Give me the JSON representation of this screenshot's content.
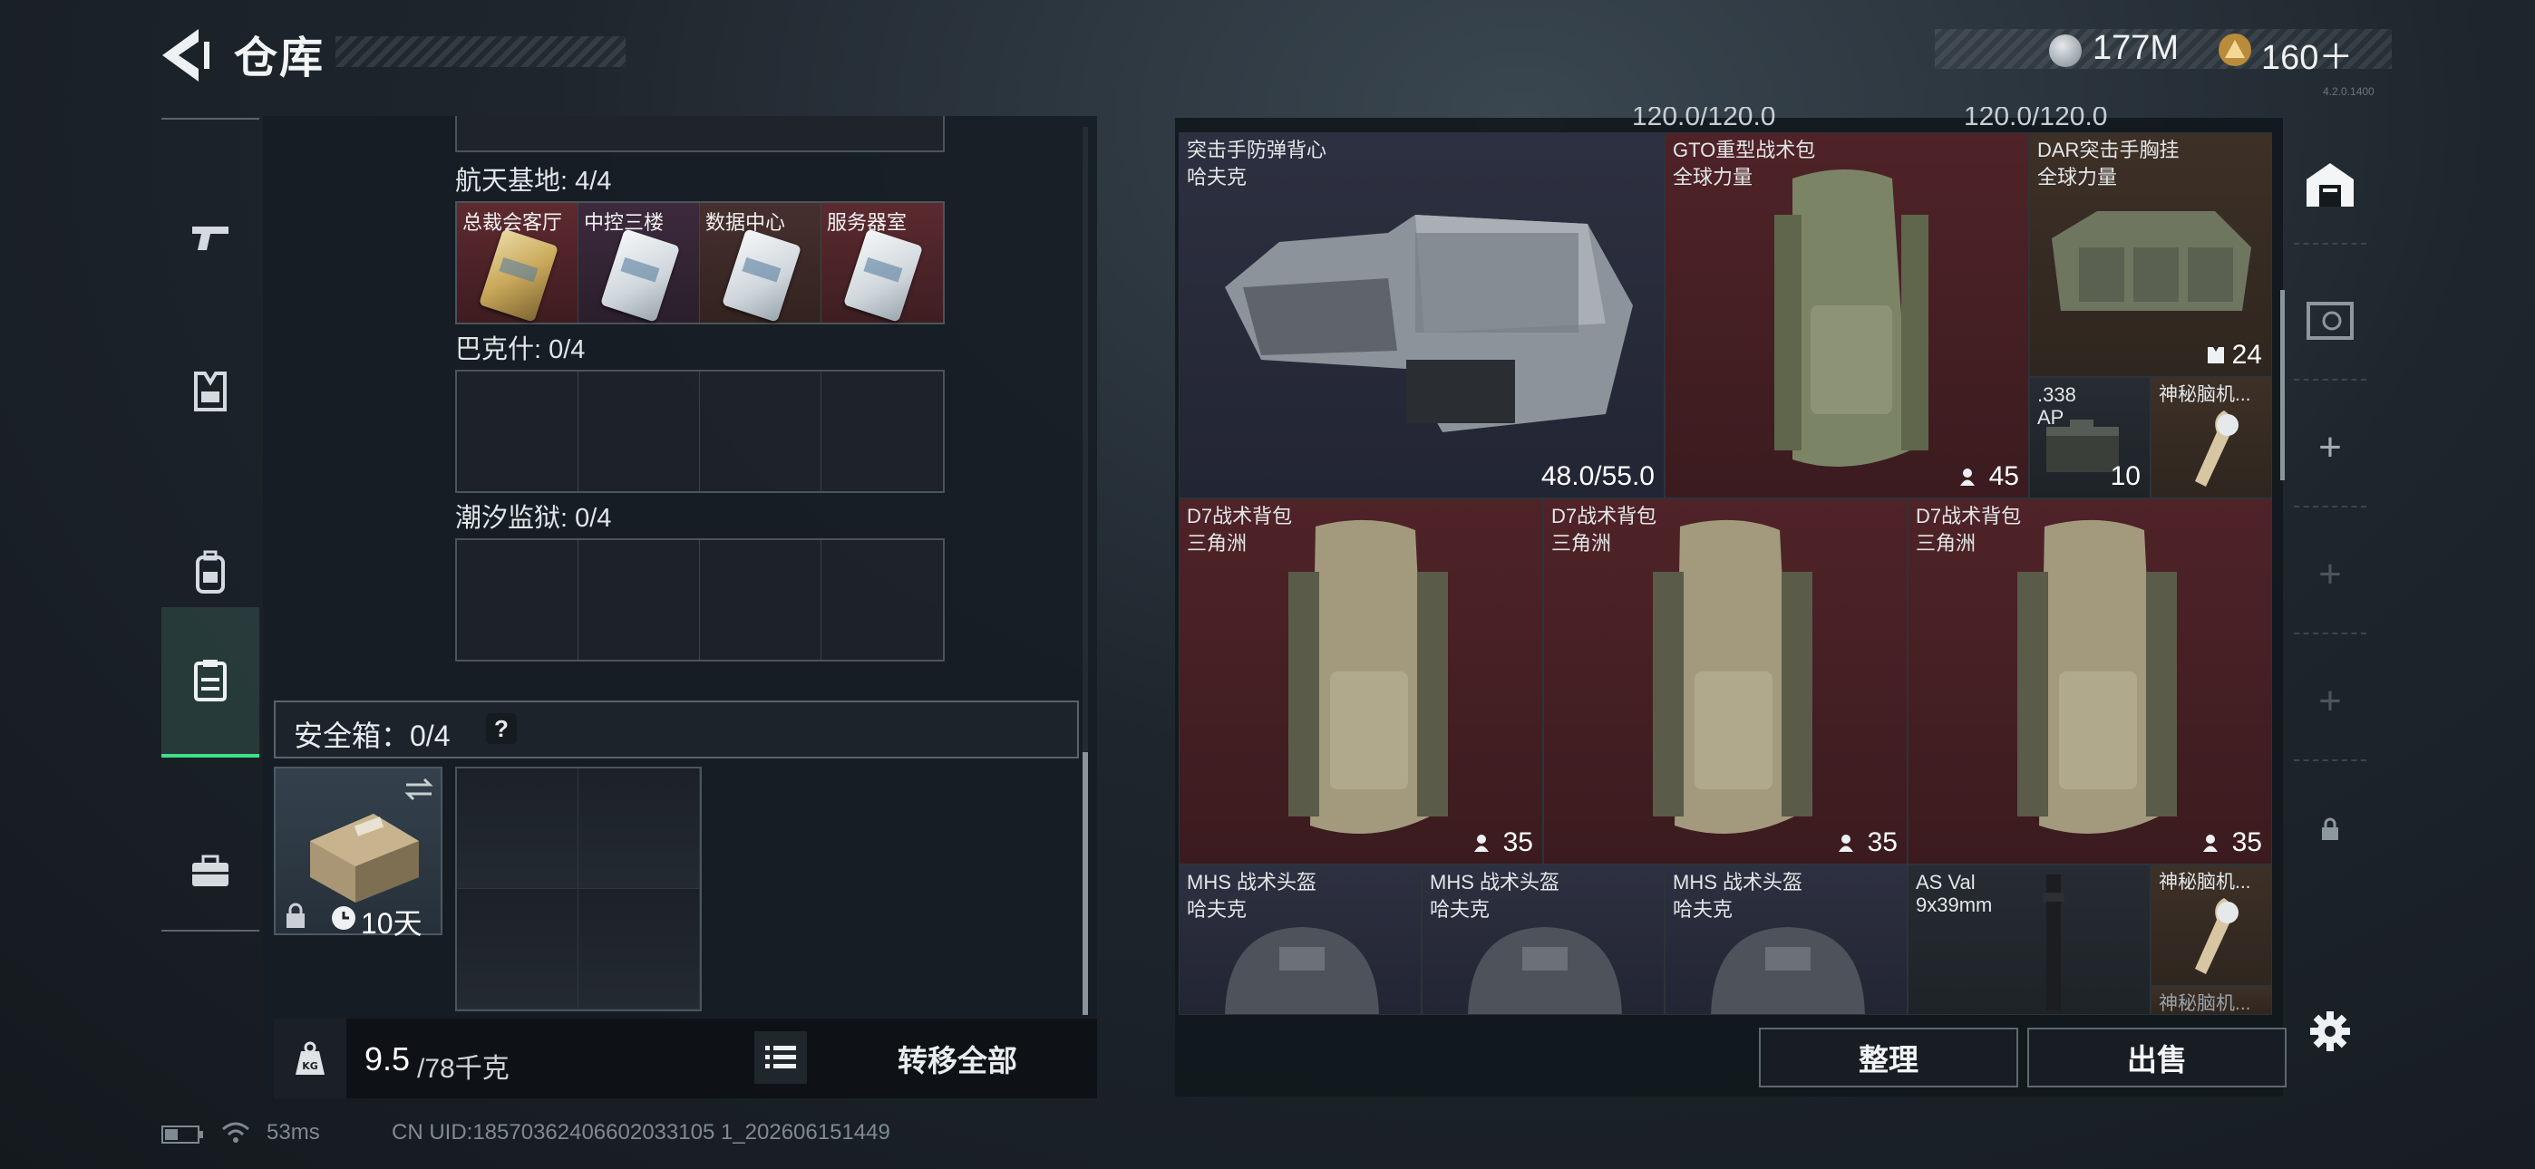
{
  "header": {
    "title": "仓库",
    "currencies": [
      {
        "icon": "silver-coin-icon",
        "value": "177M"
      },
      {
        "icon": "gold-triangle-coin-icon",
        "value": "160＋"
      }
    ]
  },
  "sidebar": {
    "tabs": [
      {
        "name": "weapons",
        "icon": "pistol-icon"
      },
      {
        "name": "armor",
        "icon": "vest-icon"
      },
      {
        "name": "backpack",
        "icon": "backpack-icon"
      },
      {
        "name": "containers",
        "icon": "clipboard-icon",
        "active": true
      },
      {
        "name": "items",
        "icon": "toolbox-icon"
      }
    ]
  },
  "left": {
    "sections": [
      {
        "label": "航天基地: 4/4",
        "cards": [
          "总裁会客厅",
          "中控三楼",
          "数据中心",
          "服务器室"
        ]
      },
      {
        "label": "巴克什: 0/4"
      },
      {
        "label": "潮汐监狱: 0/4"
      }
    ],
    "safe_box": {
      "label": "安全箱：0/4",
      "help": "?",
      "duration": "10天"
    },
    "weight": {
      "current": "9.5",
      "max": "/78千克"
    },
    "transfer_all": "转移全部"
  },
  "right": {
    "items": [
      {
        "id": "vest",
        "name": "突击手防弹背心",
        "sub": "哈夫克",
        "count": "48.0/55.0",
        "color": "navy"
      },
      {
        "id": "gto",
        "name": "GTO重型战术包",
        "sub": "全球力量",
        "count": "45",
        "color": "red"
      },
      {
        "id": "dar",
        "name": "DAR突击手胸挂",
        "sub": "全球力量",
        "count": "24",
        "color": "brown"
      },
      {
        "id": "ammo",
        "name": ".338",
        "sub": "AP",
        "count": "10",
        "color": "dark"
      },
      {
        "id": "mystery1",
        "name": "神秘脑机...",
        "sub": "",
        "count": "",
        "color": "brown"
      },
      {
        "id": "d7a",
        "name": "D7战术背包",
        "sub": "三角洲",
        "count": "35",
        "color": "red"
      },
      {
        "id": "d7b",
        "name": "D7战术背包",
        "sub": "三角洲",
        "count": "35",
        "color": "red"
      },
      {
        "id": "d7c",
        "name": "D7战术背包",
        "sub": "三角洲",
        "count": "35",
        "color": "red"
      },
      {
        "id": "helm1",
        "name": "MHS 战术头盔",
        "sub": "哈夫克",
        "count": "",
        "color": "navy"
      },
      {
        "id": "helm2",
        "name": "MHS 战术头盔",
        "sub": "哈夫克",
        "count": "",
        "color": "navy"
      },
      {
        "id": "helm3",
        "name": "MHS 战术头盔",
        "sub": "哈夫克",
        "count": "",
        "color": "navy"
      },
      {
        "id": "asval",
        "name": "AS Val",
        "sub": "9x39mm",
        "count": "",
        "color": "dark"
      },
      {
        "id": "mystery2",
        "name": "神秘脑机...",
        "sub": "",
        "count": "",
        "color": "brown"
      },
      {
        "id": "mystery3",
        "name": "神秘脑机...",
        "sub": "",
        "count": "",
        "color": "brown"
      }
    ],
    "top_partial": [
      "120.0/120.0",
      "120.0/120.0"
    ],
    "buttons": {
      "organize": "整理",
      "sell": "出售"
    }
  },
  "status": {
    "ping": "53ms",
    "uid": "CN UID:18570362406602033105 1_202606151449",
    "version": "4.2.0.1400"
  }
}
